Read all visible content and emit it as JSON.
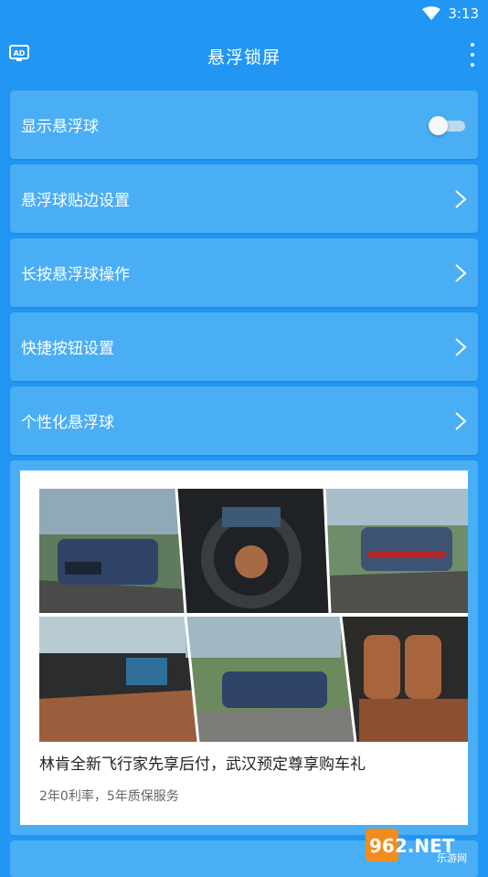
{
  "status_bar": {
    "time": "3:13"
  },
  "app_bar": {
    "title": "悬浮锁屏",
    "ad_icon_text": "AD"
  },
  "settings": {
    "items": [
      {
        "label": "显示悬浮球",
        "control": "toggle",
        "enabled": false
      },
      {
        "label": "悬浮球贴边设置",
        "control": "chevron"
      },
      {
        "label": "长按悬浮球操作",
        "control": "chevron"
      },
      {
        "label": "快捷按钮设置",
        "control": "chevron"
      },
      {
        "label": "个性化悬浮球",
        "control": "chevron"
      }
    ]
  },
  "ad": {
    "title": "林肯全新飞行家先享后付，武汉预定尊享购车礼",
    "subtitle": "2年0利率，5年质保服务"
  },
  "watermark": {
    "brand": "962.NET",
    "sub": "乐游网"
  },
  "colors": {
    "primary": "#2196F3",
    "card": "#4AAEF5"
  }
}
